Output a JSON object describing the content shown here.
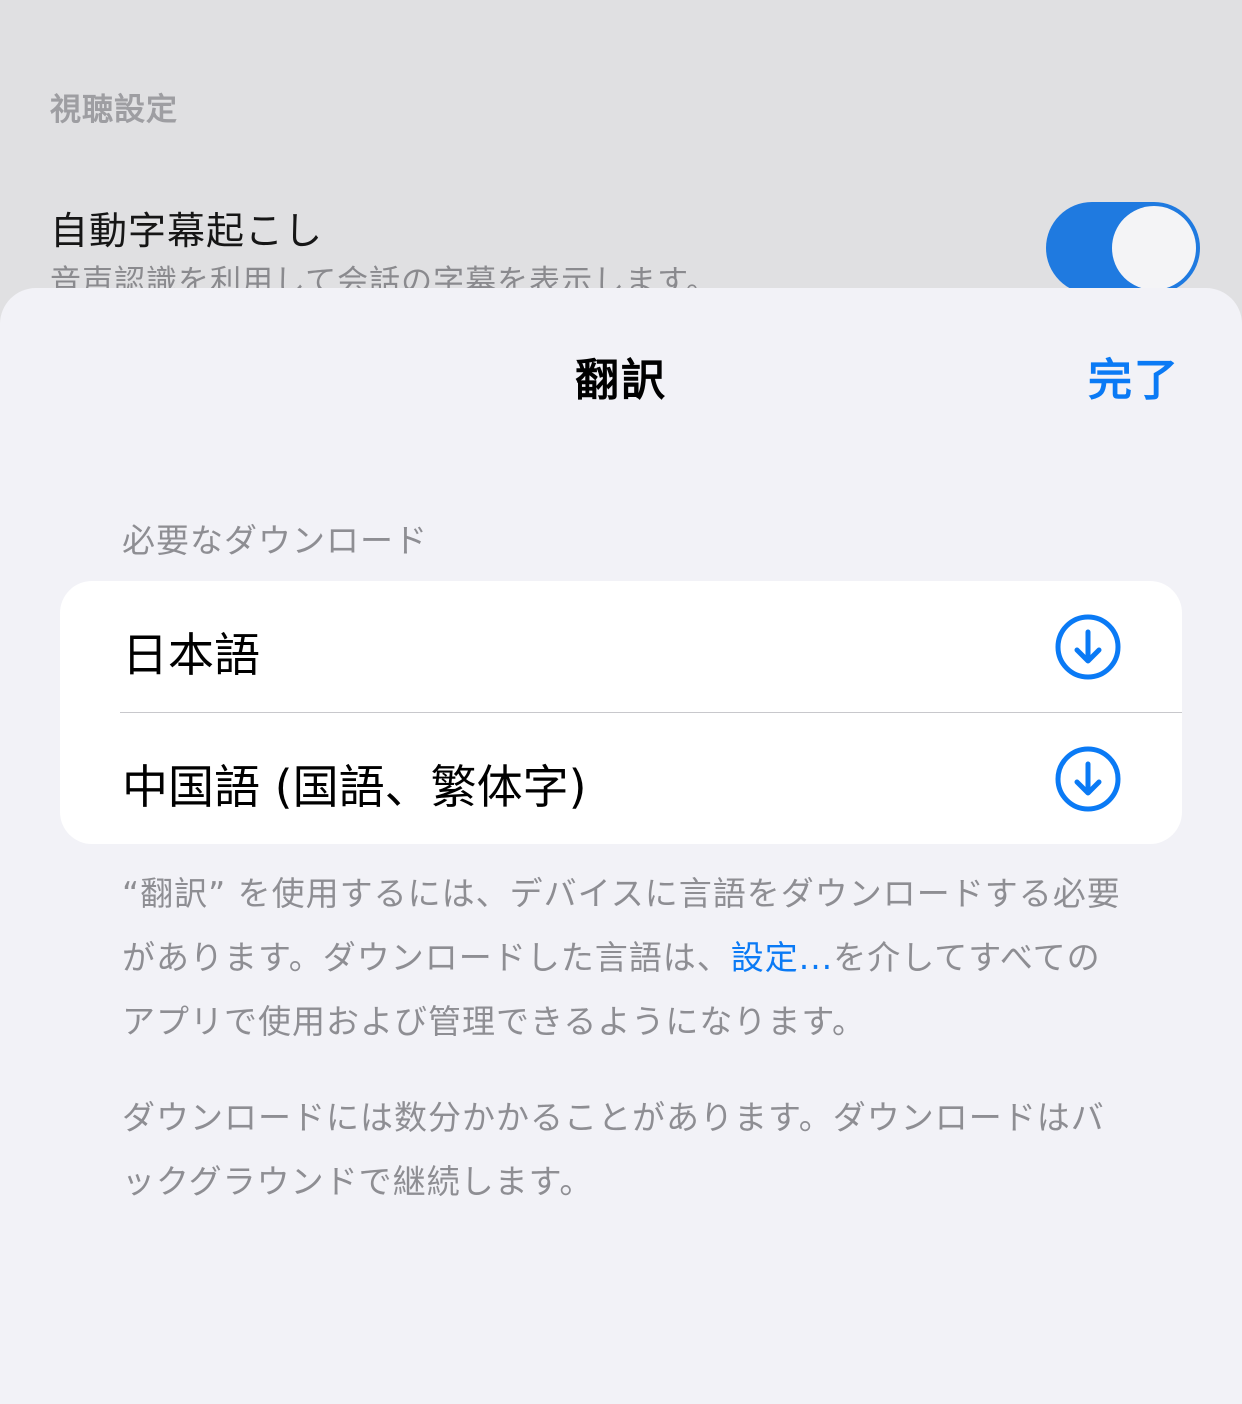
{
  "background": {
    "section_title": "視聴設定",
    "row_title": "自動字幕起こし",
    "row_subtitle": "音声認識を利用して会話の字幕を表示します。",
    "toggle_on": true,
    "toggle_color": "#1f7ae0"
  },
  "sheet": {
    "title": "翻訳",
    "done_label": "完了",
    "section_header": "必要なダウンロード",
    "languages": [
      {
        "label": "日本語",
        "icon": "download-circle-icon"
      },
      {
        "label": "中国語 (国語、繁体字)",
        "icon": "download-circle-icon"
      }
    ],
    "footer": {
      "p1_before": "“翻訳” を使用するには、デバイスに言語をダウンロードする必要があります。ダウンロードした言語は、",
      "p1_link": "設定...",
      "p1_after": "を介してすべてのアプリで使用および管理できるようになります。",
      "p2": "ダウンロードには数分かかることがあります。ダウンロードはバックグラウンドで継続します。"
    }
  },
  "colors": {
    "accent": "#0a7af5",
    "sheet_bg": "#f2f2f7",
    "dim_bg": "#e0e0e2",
    "secondary_text": "#8e8e93"
  }
}
